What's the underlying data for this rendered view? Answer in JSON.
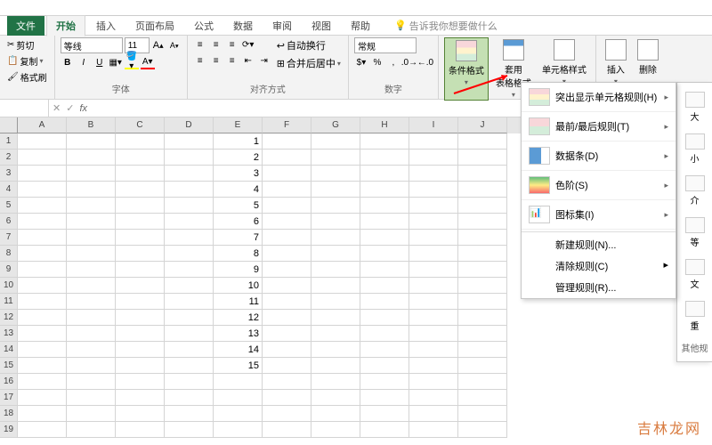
{
  "tabs": {
    "file": "文件",
    "home": "开始",
    "insert": "插入",
    "layout": "页面布局",
    "formulas": "公式",
    "data": "数据",
    "review": "审阅",
    "view": "视图",
    "help": "帮助",
    "tellme": "告诉我你想要做什么"
  },
  "clipboard": {
    "cut": "剪切",
    "copy": "复制",
    "format": "格式刷"
  },
  "font": {
    "name": "等线",
    "size": "11",
    "group_label": "字体",
    "increase": "A",
    "decrease": "A",
    "bold": "B",
    "italic": "I",
    "underline": "U"
  },
  "alignment": {
    "wrap": "自动换行",
    "merge": "合并后居中",
    "group_label": "对齐方式"
  },
  "number": {
    "format": "常规",
    "group_label": "数字"
  },
  "styles": {
    "conditional": "条件格式",
    "table": "套用\n表格格式",
    "cell": "单元格样式"
  },
  "cells_group": {
    "insert": "插入",
    "delete": "删除"
  },
  "columns": [
    "A",
    "B",
    "C",
    "D",
    "E",
    "F",
    "G",
    "H",
    "I",
    "J"
  ],
  "row_data": [
    "1",
    "2",
    "3",
    "4",
    "5",
    "6",
    "7",
    "8",
    "9",
    "10",
    "11",
    "12",
    "13",
    "14",
    "15"
  ],
  "cf_menu": {
    "highlight": "突出显示单元格规则(H)",
    "toprules": "最前/最后规则(T)",
    "databars": "数据条(D)",
    "colorscales": "色阶(S)",
    "iconsets": "图标集(I)",
    "newrule": "新建规则(N)...",
    "clearrules": "清除规则(C)",
    "manage": "管理规则(R)..."
  },
  "side": {
    "i1": "大",
    "i2": "小",
    "i3": "介",
    "i4": "等",
    "i5": "文",
    "i6": "重",
    "other": "其他规"
  },
  "watermark": "吉林龙网"
}
